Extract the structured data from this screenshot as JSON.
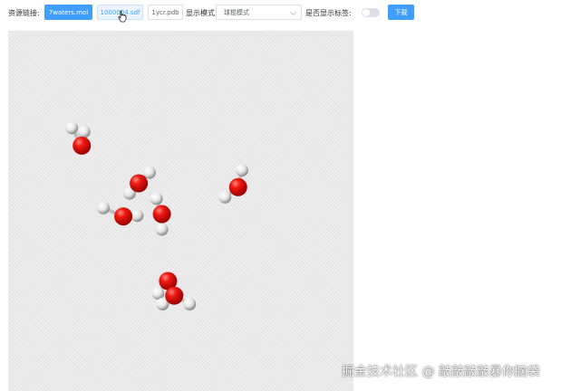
{
  "toolbar": {
    "resource_label": "资源链接:",
    "files": [
      {
        "label": "7waters.mol",
        "state": "primary"
      },
      {
        "label": "1000004.sdf",
        "state": "hover"
      },
      {
        "label": "1ycr.pdb",
        "state": "default"
      }
    ],
    "display_mode_label": "显示模式:",
    "display_mode_value": "球棍模式",
    "show_labels_label": "是否显示标签:",
    "show_labels_on": false,
    "download_label": "下载"
  },
  "colors": {
    "primary": "#409eff",
    "oxygen": "#e8100e",
    "hydrogen": "#f2f2f2",
    "viewer_bg": "#efefef"
  },
  "molecule_viewer": {
    "molecule": "7waters.mol",
    "style": "ball-and-stick",
    "atoms": [
      {
        "element": "O",
        "x": -6.4,
        "y": 4.3
      },
      {
        "element": "H",
        "x": -7.05,
        "y": 5.45
      },
      {
        "element": "H",
        "x": -6.25,
        "y": 5.2
      },
      {
        "element": "O",
        "x": -2.7,
        "y": 1.85
      },
      {
        "element": "H",
        "x": -2.0,
        "y": 2.55
      },
      {
        "element": "H",
        "x": -3.3,
        "y": 1.2
      },
      {
        "element": "O",
        "x": 3.75,
        "y": 1.6
      },
      {
        "element": "H",
        "x": 4.0,
        "y": 2.7
      },
      {
        "element": "H",
        "x": 2.9,
        "y": 0.95
      },
      {
        "element": "O",
        "x": -3.7,
        "y": -0.3
      },
      {
        "element": "H",
        "x": -5.0,
        "y": 0.25
      },
      {
        "element": "H",
        "x": -2.8,
        "y": -0.25
      },
      {
        "element": "O",
        "x": -1.2,
        "y": -0.15
      },
      {
        "element": "H",
        "x": -1.55,
        "y": 0.85
      },
      {
        "element": "H",
        "x": -1.2,
        "y": -1.15
      },
      {
        "element": "O",
        "x": -0.8,
        "y": -4.5
      },
      {
        "element": "H",
        "x": -1.45,
        "y": -5.3
      },
      {
        "element": "H",
        "x": -0.2,
        "y": -5.35
      },
      {
        "element": "O",
        "x": -0.4,
        "y": -5.45
      },
      {
        "element": "H",
        "x": -1.15,
        "y": -6.0
      },
      {
        "element": "H",
        "x": 0.6,
        "y": -6.0
      }
    ],
    "bonds": [
      [
        0,
        1
      ],
      [
        0,
        2
      ],
      [
        3,
        4
      ],
      [
        3,
        5
      ],
      [
        6,
        7
      ],
      [
        6,
        8
      ],
      [
        9,
        10
      ],
      [
        9,
        11
      ],
      [
        12,
        13
      ],
      [
        12,
        14
      ],
      [
        15,
        16
      ],
      [
        15,
        17
      ],
      [
        18,
        19
      ],
      [
        18,
        20
      ]
    ]
  },
  "watermark": "掘金技术社区 @ 敲敲敲敲暴你脑袋"
}
